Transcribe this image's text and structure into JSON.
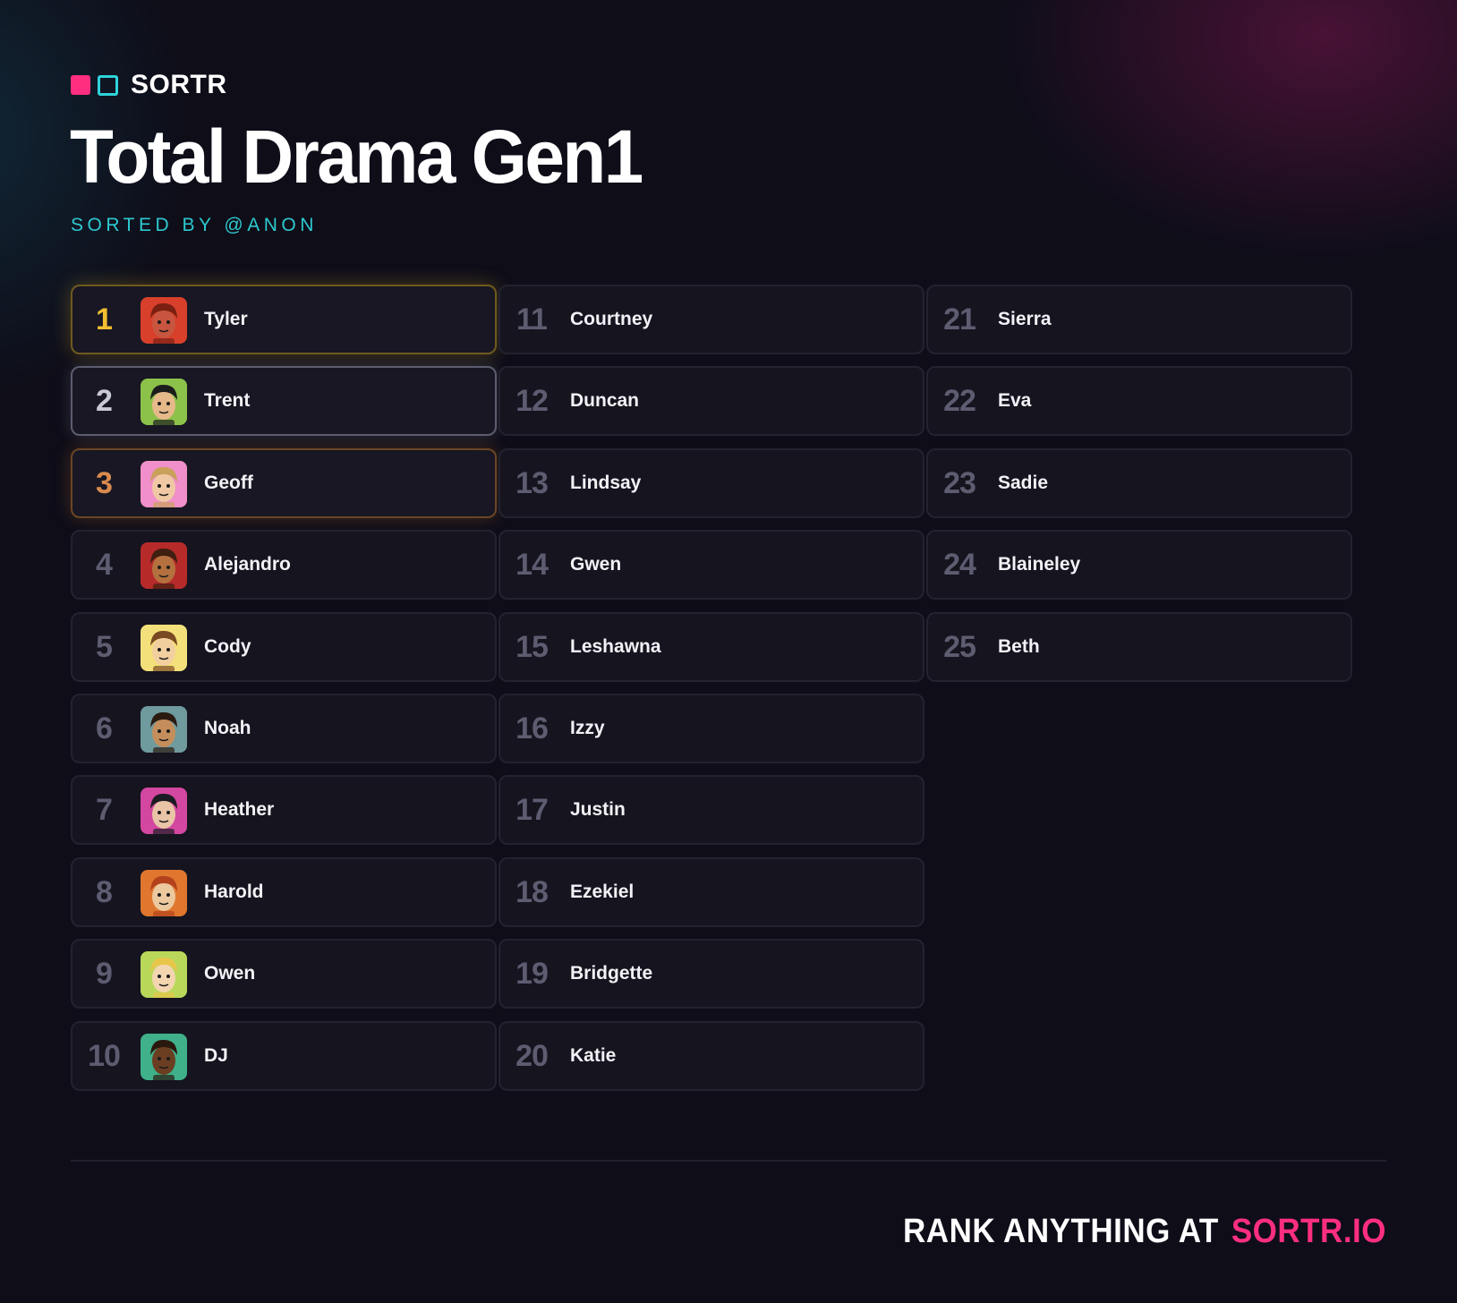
{
  "brand": {
    "name": "SORTR",
    "accent_pink": "#ff2e7e",
    "accent_teal": "#2ed3d9"
  },
  "title": "Total Drama Gen1",
  "sorted_by": "SORTED BY @ANON",
  "ranking": [
    {
      "rank": "1",
      "name": "Tyler",
      "avatar": {
        "bg": "#d8402c",
        "skin": "#c8553f",
        "hair": "#7a1f12"
      }
    },
    {
      "rank": "2",
      "name": "Trent",
      "avatar": {
        "bg": "#8cc24a",
        "skin": "#e6b98a",
        "hair": "#1c1c1c"
      }
    },
    {
      "rank": "3",
      "name": "Geoff",
      "avatar": {
        "bg": "#f08fc9",
        "skin": "#f0c8a4",
        "hair": "#c9a15a"
      }
    },
    {
      "rank": "4",
      "name": "Alejandro",
      "avatar": {
        "bg": "#b72a2a",
        "skin": "#b4713f",
        "hair": "#3e1f10"
      }
    },
    {
      "rank": "5",
      "name": "Cody",
      "avatar": {
        "bg": "#f4e07a",
        "skin": "#f2cf9e",
        "hair": "#7a4a22"
      }
    },
    {
      "rank": "6",
      "name": "Noah",
      "avatar": {
        "bg": "#6f9a9e",
        "skin": "#c48e5c",
        "hair": "#2a1a10"
      }
    },
    {
      "rank": "7",
      "name": "Heather",
      "avatar": {
        "bg": "#d447a0",
        "skin": "#e9c4a6",
        "hair": "#1b1b22"
      }
    },
    {
      "rank": "8",
      "name": "Harold",
      "avatar": {
        "bg": "#e0772e",
        "skin": "#ecc89f",
        "hair": "#b2411c"
      }
    },
    {
      "rank": "9",
      "name": "Owen",
      "avatar": {
        "bg": "#b9d85a",
        "skin": "#f3d6b0",
        "hair": "#e8c64a"
      }
    },
    {
      "rank": "10",
      "name": "DJ",
      "avatar": {
        "bg": "#3fb08a",
        "skin": "#6b3e22",
        "hair": "#2a180e"
      }
    },
    {
      "rank": "11",
      "name": "Courtney"
    },
    {
      "rank": "12",
      "name": "Duncan"
    },
    {
      "rank": "13",
      "name": "Lindsay"
    },
    {
      "rank": "14",
      "name": "Gwen"
    },
    {
      "rank": "15",
      "name": "Leshawna"
    },
    {
      "rank": "16",
      "name": "Izzy"
    },
    {
      "rank": "17",
      "name": "Justin"
    },
    {
      "rank": "18",
      "name": "Ezekiel"
    },
    {
      "rank": "19",
      "name": "Bridgette"
    },
    {
      "rank": "20",
      "name": "Katie"
    },
    {
      "rank": "21",
      "name": "Sierra"
    },
    {
      "rank": "22",
      "name": "Eva"
    },
    {
      "rank": "23",
      "name": "Sadie"
    },
    {
      "rank": "24",
      "name": "Blaineley"
    },
    {
      "rank": "25",
      "name": "Beth"
    }
  ],
  "podium_colors": {
    "gold": "#f2bf30",
    "silver": "#c9c9d4",
    "bronze": "#d98a4e"
  },
  "footer": {
    "prefix": "RANK ANYTHING AT",
    "link": "SORTR.IO"
  }
}
